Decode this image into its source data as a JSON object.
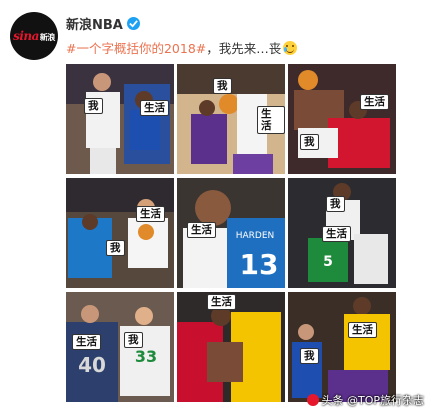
{
  "post": {
    "username": "新浪NBA",
    "avatar_logo": "sina",
    "avatar_logo_sub": "新浪",
    "tag": "#一个字概括你的2018#",
    "text": "，我先来…丧",
    "emoji": "crying-laughing-emoji"
  },
  "grid": {
    "tiles": [
      {
        "labels": [
          "我",
          "生活"
        ]
      },
      {
        "labels": [
          "我",
          "生活"
        ]
      },
      {
        "labels": [
          "生活",
          "我"
        ]
      },
      {
        "labels": [
          "生活",
          "我"
        ]
      },
      {
        "labels": [
          "生活"
        ]
      },
      {
        "labels": [
          "我",
          "生活"
        ]
      },
      {
        "labels": [
          "生活",
          "我"
        ]
      },
      {
        "labels": [
          "生活"
        ]
      },
      {
        "labels": [
          "生活",
          "我"
        ]
      }
    ]
  },
  "watermark": {
    "text": "头条 @TOP旅行杂志"
  }
}
